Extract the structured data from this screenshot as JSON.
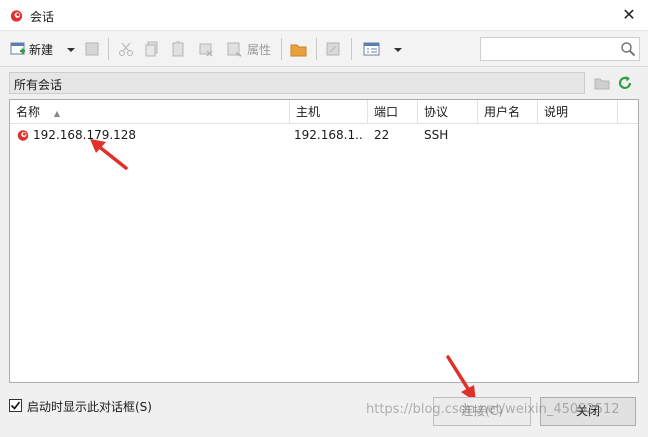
{
  "window": {
    "title": "会话",
    "close_glyph": "✕"
  },
  "toolbar": {
    "new_label": "新建",
    "properties_label": "属性"
  },
  "search": {
    "placeholder": ""
  },
  "path": {
    "label": "所有会话"
  },
  "table": {
    "columns": [
      "名称",
      "主机",
      "端口",
      "协议",
      "用户名",
      "说明"
    ],
    "sort_indicator": "▲",
    "rows": [
      {
        "name": "192.168.179.128",
        "host": "192.168.1...",
        "port": "22",
        "protocol": "SSH",
        "user": "",
        "desc": ""
      }
    ]
  },
  "footer": {
    "startup_checkbox_label": "启动时显示此对话框(S)",
    "startup_checked": true,
    "connect_label": "连接(C)",
    "close_label": "关闭",
    "watermark": "https://blog.csdn.net/weixin_45092512"
  },
  "colors": {
    "accent_red": "#e0302a",
    "refresh_green": "#2ea043",
    "folder_orange": "#e9a23b"
  }
}
